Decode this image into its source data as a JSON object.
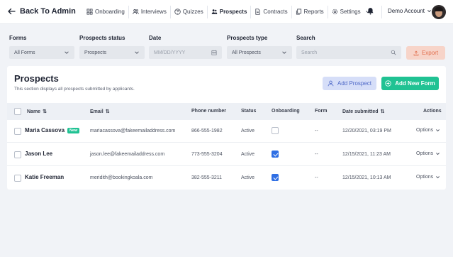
{
  "header": {
    "back_label": "Back To Admin",
    "nav": [
      {
        "label": "Onboarding",
        "icon": "grid-icon"
      },
      {
        "label": "Interviews",
        "icon": "people-icon"
      },
      {
        "label": "Quizzes",
        "icon": "question-icon"
      },
      {
        "label": "Prospects",
        "icon": "prospects-icon",
        "active": true
      },
      {
        "label": "Contracts",
        "icon": "document-icon"
      },
      {
        "label": "Reports",
        "icon": "copy-icon"
      },
      {
        "label": "Settings",
        "icon": "gear-icon"
      }
    ],
    "account_label": "Demo Account"
  },
  "filters": {
    "forms_label": "Forms",
    "forms_value": "All Forms",
    "status_label": "Prospects status",
    "status_value": "Prospects",
    "date_label": "Date",
    "date_placeholder": "MM/DD/YYYY",
    "type_label": "Prospects type",
    "type_value": "All Prospects",
    "search_label": "Search",
    "search_placeholder": "Search",
    "export_label": "Export"
  },
  "card": {
    "title": "Prospects",
    "subtitle": "This section displays all prospects submitted by applicants.",
    "add_prospect_label": "Add Prospect",
    "add_form_label": "Add New Form"
  },
  "table": {
    "columns": {
      "name": "Name",
      "email": "Email",
      "phone": "Phone number",
      "status": "Status",
      "onboarding": "Onboarding",
      "form": "Form",
      "date": "Date submitted",
      "actions": "Actions"
    },
    "rows": [
      {
        "name": "Maria Cassova",
        "badge": "New",
        "email": "mariacassova@fakeemailaddress.com",
        "phone": "866-555-1982",
        "status": "Active",
        "onboarding": false,
        "form": "--",
        "date": "12/20/2021, 03:19 PM",
        "action": "Options"
      },
      {
        "name": "Jason Lee",
        "badge": "",
        "email": "jason.lee@fakeemailaddress.com",
        "phone": "773-555-3204",
        "status": "Active",
        "onboarding": true,
        "form": "--",
        "date": "12/15/2021, 11:23 AM",
        "action": "Options"
      },
      {
        "name": "Katie Freeman",
        "badge": "",
        "email": "meridith@bookingkoala.com",
        "phone": "382-555-3211",
        "status": "Active",
        "onboarding": true,
        "form": "--",
        "date": "12/15/2021, 10:13 AM",
        "action": "Options"
      }
    ]
  },
  "colors": {
    "accent_green": "#20c293",
    "accent_blue_light": "#d6def8",
    "export_bg": "#f7d4c9",
    "checkbox_blue": "#2f6fe4"
  }
}
